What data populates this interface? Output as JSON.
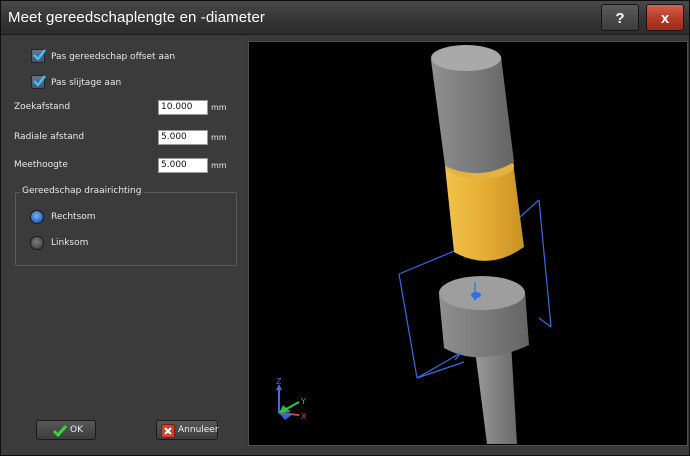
{
  "window": {
    "title": "Meet gereedschaplengte en -diameter"
  },
  "titlebar": {
    "help_label": "?",
    "close_label": "x"
  },
  "options": [
    {
      "label": "Pas gereedschap offset aan",
      "checked": true
    },
    {
      "label": "Pas slijtage aan",
      "checked": true
    }
  ],
  "fields": [
    {
      "label": "Zoekafstand",
      "value": "10.000",
      "unit": "mm"
    },
    {
      "label": "Radiale afstand",
      "value": "5.000",
      "unit": "mm"
    },
    {
      "label": "Meethoogte",
      "value": "5.000",
      "unit": "mm"
    }
  ],
  "rotation": {
    "title": "Gereedschap draairichting",
    "options": [
      {
        "label": "Rechtsom",
        "selected": true
      },
      {
        "label": "Linksom",
        "selected": false
      }
    ]
  },
  "buttons": {
    "ok": "OK",
    "cancel": "Annuleer"
  },
  "viewport": {
    "axes": {
      "x": "X",
      "y": "Y",
      "z": "Z"
    },
    "colors": {
      "tool_shank": "#8a8a8a",
      "tool_holder": "#e8b23a",
      "probe_frame": "#2f6fe6",
      "axis_x": "#e23b3b",
      "axis_y": "#2ec94a",
      "axis_z": "#3b6fe8"
    }
  }
}
